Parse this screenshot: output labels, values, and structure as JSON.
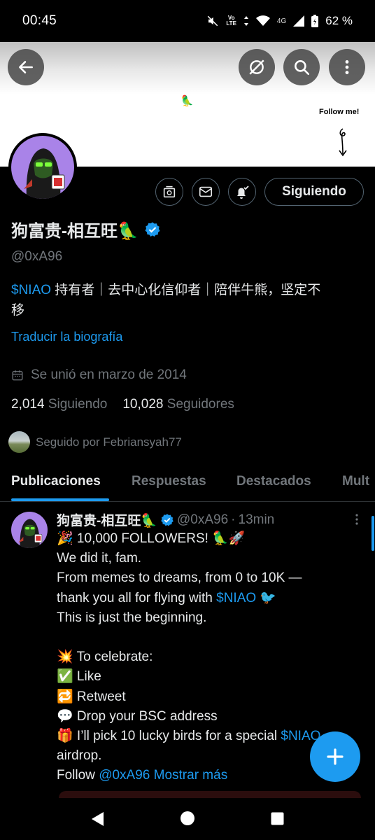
{
  "status_bar": {
    "time": "00:45",
    "volte_top": "Vo",
    "volte_bottom": "LTE",
    "network": "4G",
    "battery": "62 %"
  },
  "banner": {
    "follow_text": "Follow me!",
    "parrot_emoji": "🦜"
  },
  "header_buttons": {
    "back_icon": "arrow-left-icon",
    "grok_icon": "grok-icon",
    "search_icon": "search-icon",
    "more_icon": "more-vertical-icon"
  },
  "profile": {
    "display_name": "狗富贵-相互旺🦜",
    "handle": "@0xA96",
    "bio_link": "$NIAO",
    "bio_text_1": " 持有者｜去中心化信仰者｜陪伴牛熊，坚定不",
    "bio_text_2": "移",
    "translate": "Traducir la biografía",
    "joined": "Se unió en marzo de 2014",
    "following_count": "2,014",
    "following_label": "Siguiendo",
    "followers_count": "10,028",
    "followers_label": "Seguidores",
    "followed_by": "Seguido por Febriansyah77",
    "follow_button": "Siguiendo",
    "verified_color": "#1d9bf0"
  },
  "tabs": [
    {
      "label": "Publicaciones",
      "active": true
    },
    {
      "label": "Respuestas",
      "active": false
    },
    {
      "label": "Destacados",
      "active": false
    },
    {
      "label": "Mult",
      "active": false
    }
  ],
  "tweet": {
    "name": "狗富贵-相互旺🦜",
    "handle": "@0xA96",
    "dot": "·",
    "time": "13min",
    "lines": {
      "l1": "🎉 10,000 FOLLOWERS! 🦜🚀",
      "l2": "We did it, fam.",
      "l3": "From memes to dreams, from 0 to 10K —",
      "l4_pre": "thank you all for flying with ",
      "l4_link": "$NIAO",
      "l4_post": " 🐦",
      "l5": "This is just the beginning.",
      "l6": "💥 To celebrate:",
      "l7": "✅ Like",
      "l8": "🔁 Retweet",
      "l9": "💬 Drop your BSC address",
      "l10_pre": "🎁 I’ll pick 10 lucky birds for a special ",
      "l10_link": "$NIAO",
      "l11": "airdrop.",
      "l12_pre": "Follow ",
      "l12_link": "@0xA96",
      "l12_more": " Mostrar más"
    }
  },
  "colors": {
    "accent": "#1d9bf0",
    "background": "#000000",
    "secondary_text": "#71767b",
    "avatar_bg": "#a983e8"
  }
}
